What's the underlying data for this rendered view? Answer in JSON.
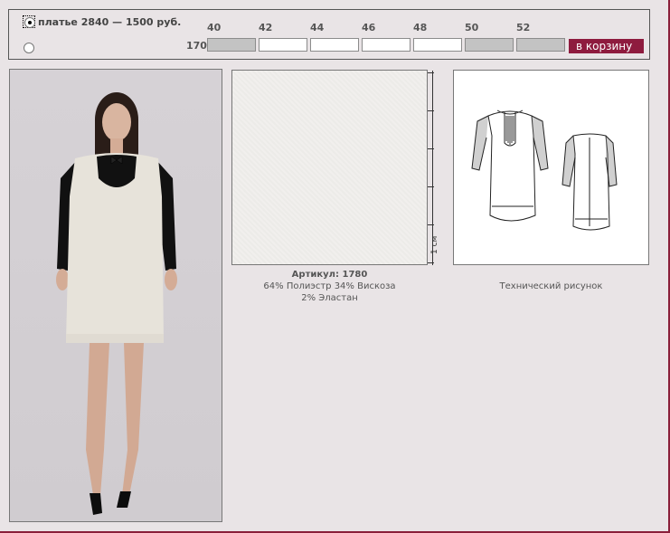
{
  "order": {
    "product_name": "платье",
    "product_code": "2840",
    "price": "1500 руб.",
    "label": "платье  2840 — 1500 руб.",
    "height": "170",
    "sizes": [
      {
        "size": "40",
        "available": false
      },
      {
        "size": "42",
        "available": true
      },
      {
        "size": "44",
        "available": true
      },
      {
        "size": "46",
        "available": true
      },
      {
        "size": "48",
        "available": true
      },
      {
        "size": "50",
        "available": false
      },
      {
        "size": "52",
        "available": false
      }
    ],
    "cart_button": "в корзину"
  },
  "fabric": {
    "ruler_label": "1 см",
    "article": "Артикул: 1780",
    "composition_line1": "64% Полиэстр 34% Вискоза",
    "composition_line2": "2% Эластан"
  },
  "tech": {
    "caption": "Технический рисунок"
  },
  "colors": {
    "background": "#e9e4e6",
    "accent": "#8e1b3e",
    "unavailable": "#c3c3c3"
  }
}
